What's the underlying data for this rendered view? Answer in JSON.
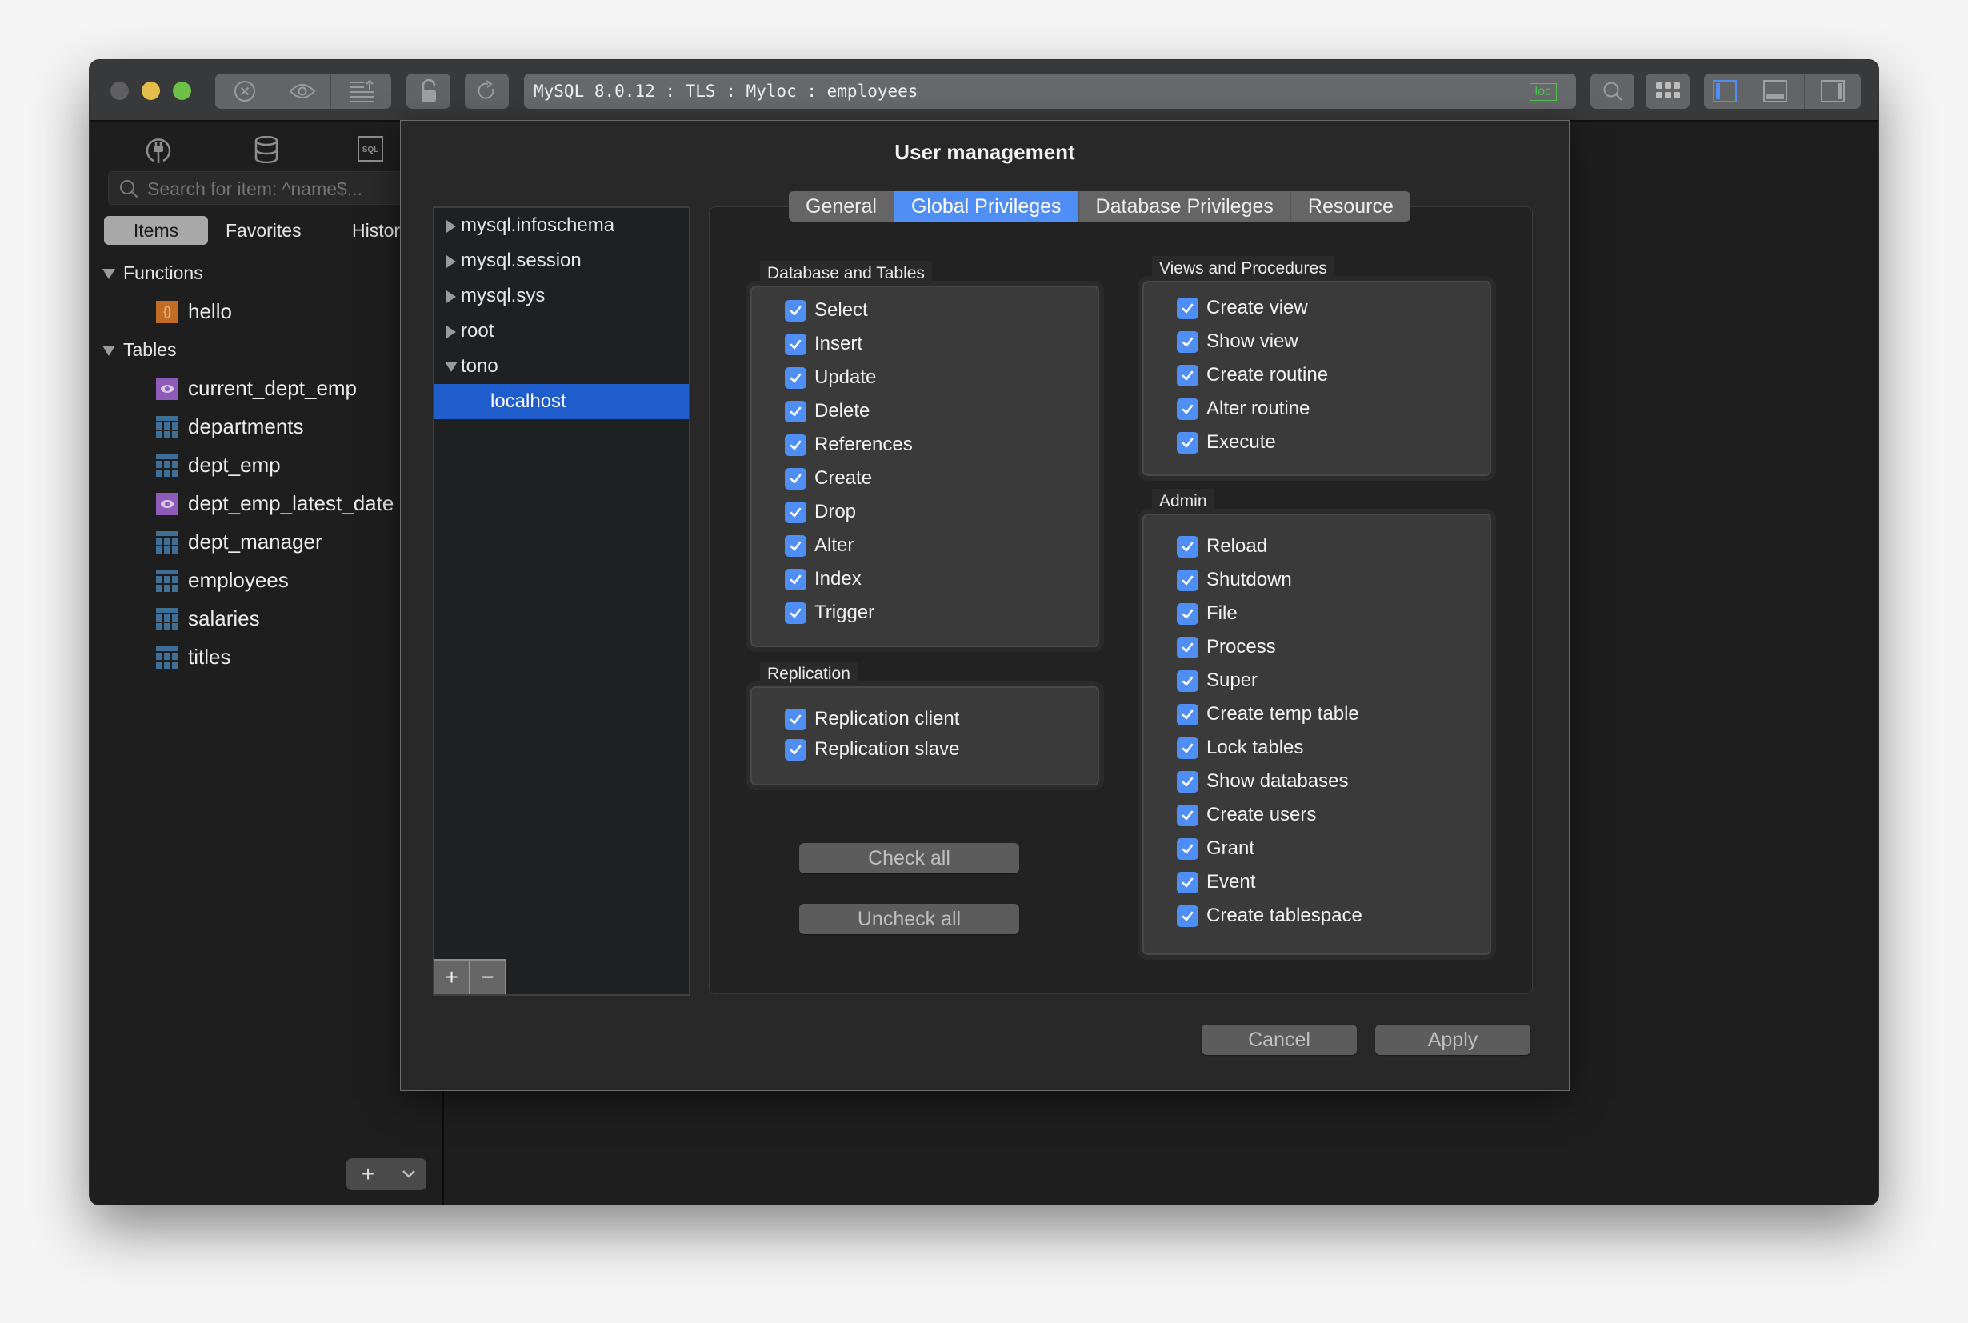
{
  "window": {
    "connection_title": "MySQL 8.0.12 : TLS : Myloc : employees",
    "connection_badge": "loc",
    "badge_color": "#4fc34f",
    "traffic_lights": {
      "close": "#5f5f61",
      "minimize": "#e3bd49",
      "zoom": "#6cbf47"
    },
    "toolbar": [
      {
        "name": "stop-icon"
      },
      {
        "name": "preview-icon"
      },
      {
        "name": "export-icon"
      },
      {
        "name": "lock-icon"
      },
      {
        "name": "refresh-icon"
      },
      {
        "name": "search-icon"
      },
      {
        "name": "apps-grid-icon"
      },
      {
        "name": "toggle-left-panel-icon"
      },
      {
        "name": "toggle-bottom-panel-icon"
      },
      {
        "name": "toggle-right-panel-icon"
      }
    ]
  },
  "sidebar": {
    "icons": [
      "plug-icon",
      "database-icon",
      "sql-icon"
    ],
    "search_placeholder": "Search for item: ^name$...",
    "tabs": [
      {
        "label": "Items",
        "active": true
      },
      {
        "label": "Favorites",
        "active": false
      },
      {
        "label": "History",
        "active": false
      }
    ],
    "sections": [
      {
        "label": "Functions",
        "expanded": true,
        "items": [
          {
            "name": "hello",
            "type": "function"
          }
        ]
      },
      {
        "label": "Tables",
        "expanded": true,
        "items": [
          {
            "name": "current_dept_emp",
            "type": "view"
          },
          {
            "name": "departments",
            "type": "table"
          },
          {
            "name": "dept_emp",
            "type": "table"
          },
          {
            "name": "dept_emp_latest_date",
            "type": "view"
          },
          {
            "name": "dept_manager",
            "type": "table"
          },
          {
            "name": "employees",
            "type": "table"
          },
          {
            "name": "salaries",
            "type": "table"
          },
          {
            "name": "titles",
            "type": "table"
          }
        ]
      }
    ]
  },
  "modal": {
    "title": "User management",
    "users": [
      {
        "label": "mysql.infoschema",
        "expanded": false
      },
      {
        "label": "mysql.session",
        "expanded": false
      },
      {
        "label": "mysql.sys",
        "expanded": false
      },
      {
        "label": "root",
        "expanded": false
      },
      {
        "label": "tono",
        "expanded": true
      },
      {
        "label": "localhost",
        "selected": true,
        "child": true
      }
    ],
    "tabs": [
      {
        "label": "General",
        "active": false
      },
      {
        "label": "Global Privileges",
        "active": true
      },
      {
        "label": "Database Privileges",
        "active": false
      },
      {
        "label": "Resource",
        "active": false
      }
    ],
    "groups": {
      "database_tables": {
        "label": "Database and Tables",
        "items": [
          {
            "label": "Select",
            "checked": true
          },
          {
            "label": "Insert",
            "checked": true
          },
          {
            "label": "Update",
            "checked": true
          },
          {
            "label": "Delete",
            "checked": true
          },
          {
            "label": "References",
            "checked": true
          },
          {
            "label": "Create",
            "checked": true
          },
          {
            "label": "Drop",
            "checked": true
          },
          {
            "label": "Alter",
            "checked": true
          },
          {
            "label": "Index",
            "checked": true
          },
          {
            "label": "Trigger",
            "checked": true
          }
        ]
      },
      "replication": {
        "label": "Replication",
        "items": [
          {
            "label": "Replication client",
            "checked": true
          },
          {
            "label": "Replication slave",
            "checked": true
          }
        ]
      },
      "views_procedures": {
        "label": "Views and Procedures",
        "items": [
          {
            "label": "Create view",
            "checked": true
          },
          {
            "label": "Show view",
            "checked": true
          },
          {
            "label": "Create routine",
            "checked": true
          },
          {
            "label": "Alter routine",
            "checked": true
          },
          {
            "label": "Execute",
            "checked": true
          }
        ]
      },
      "admin": {
        "label": "Admin",
        "items": [
          {
            "label": "Reload",
            "checked": true
          },
          {
            "label": "Shutdown",
            "checked": true
          },
          {
            "label": "File",
            "checked": true
          },
          {
            "label": "Process",
            "checked": true
          },
          {
            "label": "Super",
            "checked": true
          },
          {
            "label": "Create temp table",
            "checked": true
          },
          {
            "label": "Lock tables",
            "checked": true
          },
          {
            "label": "Show databases",
            "checked": true
          },
          {
            "label": "Create users",
            "checked": true
          },
          {
            "label": "Grant",
            "checked": true
          },
          {
            "label": "Event",
            "checked": true
          },
          {
            "label": "Create tablespace",
            "checked": true
          }
        ]
      }
    },
    "check_all_label": "Check all",
    "uncheck_all_label": "Uncheck all",
    "cancel_label": "Cancel",
    "apply_label": "Apply",
    "accent_color": "#4f8ef5",
    "selection_color": "#1f5ccc"
  }
}
